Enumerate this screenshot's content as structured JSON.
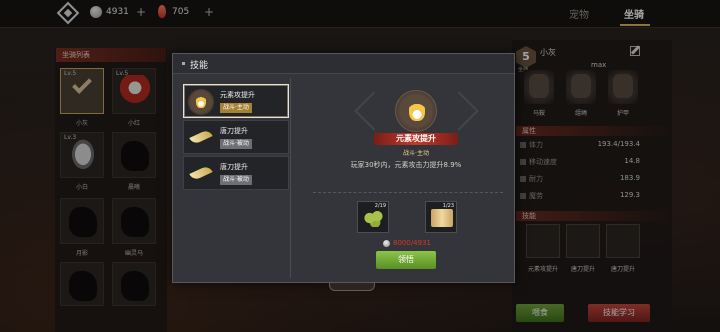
{
  "topbar": {
    "silver_amount": "4931",
    "ruby_amount": "705",
    "plus_label": "+",
    "tabs": [
      {
        "label": "宠物",
        "active": false
      },
      {
        "label": "坐骑",
        "active": true
      }
    ]
  },
  "mount_list": {
    "header": "坐骑列表",
    "items": [
      {
        "level": "Lv.5",
        "name": "小灰",
        "selected": true
      },
      {
        "level": "Lv.5",
        "name": "小红",
        "selected": false
      },
      {
        "level": "Lv.3",
        "name": "小白",
        "selected": false
      },
      {
        "level": "",
        "name": "晨曦",
        "selected": false
      },
      {
        "level": "",
        "name": "月影",
        "selected": false
      },
      {
        "level": "",
        "name": "幽灵马",
        "selected": false
      }
    ]
  },
  "modal": {
    "title": "技能",
    "skills": [
      {
        "name": "元素攻提升",
        "tag": "战斗·主动",
        "icon": "flame-icon",
        "active": true
      },
      {
        "name": "唐刀提升",
        "tag": "战斗·被动",
        "icon": "blade-icon",
        "active": false
      },
      {
        "name": "唐刀提升",
        "tag": "战斗·被动",
        "icon": "blade-icon",
        "active": false
      }
    ],
    "detail": {
      "name": "元素攻提升",
      "type": "战斗·主动",
      "description": "玩家30秒内，元素攻击力提升8.9%",
      "costs": [
        {
          "icon": "beans-icon",
          "count": "2/19"
        },
        {
          "icon": "scroll-icon",
          "count": "1/23"
        }
      ],
      "price": "8000/4931",
      "learn_button": "领悟"
    }
  },
  "right_panel": {
    "level": "5",
    "level_sub": "坐骑",
    "mount_name": "小灰",
    "max_label": "max",
    "equipment": [
      {
        "label": "马鞍"
      },
      {
        "label": "缰绳"
      },
      {
        "label": "护甲"
      }
    ],
    "attr_title": "属性",
    "stats": [
      {
        "label": "体力",
        "value": "193.4/193.4"
      },
      {
        "label": "移动速度",
        "value": "14.8"
      },
      {
        "label": "耐力",
        "value": "183.9"
      },
      {
        "label": "魔劳",
        "value": "129.3"
      }
    ],
    "skills_title": "技能",
    "skills": [
      {
        "label": "元素攻提升"
      },
      {
        "label": "唐刀提升"
      },
      {
        "label": "唐刀提升"
      }
    ],
    "feed_button": "喂食",
    "learn_button": "技能学习"
  },
  "colors": {
    "accent_gold": "#c9a45a",
    "price_red": "#d8362a",
    "learn_green": "#8cc54a",
    "ribbon_red": "#c03a2c"
  }
}
